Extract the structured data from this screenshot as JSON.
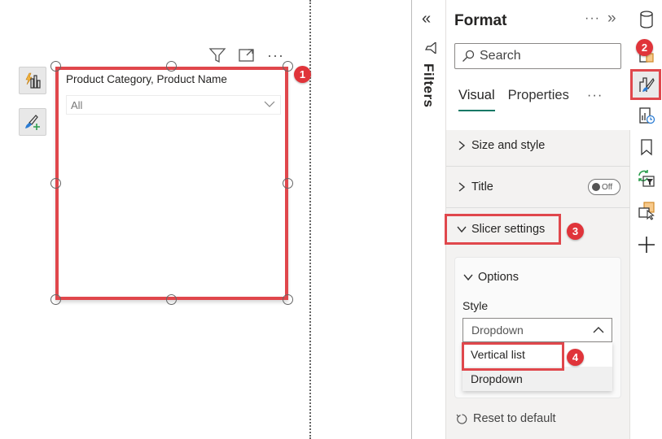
{
  "canvas": {
    "visual_header_icons": [
      "filter-icon",
      "focus-mode-icon",
      "more-options-icon"
    ],
    "side_buttons": [
      {
        "name": "build-visual-icon"
      },
      {
        "name": "format-visual-icon"
      }
    ],
    "slicer": {
      "title": "Product Category, Product Name",
      "dropdown_value": "All"
    }
  },
  "filters_pane": {
    "label": "Filters",
    "collapse_glyph": "«"
  },
  "format_pane": {
    "title": "Format",
    "more_glyph": "···",
    "expand_glyph": "»",
    "search_placeholder": "Search",
    "tabs": [
      {
        "label": "Visual",
        "active": true
      },
      {
        "label": "Properties",
        "active": false
      }
    ],
    "tabs_more": "···",
    "sections": [
      {
        "label": "Size and style",
        "expanded": false
      },
      {
        "label": "Title",
        "expanded": false,
        "toggle": "Off"
      },
      {
        "label": "Slicer settings",
        "expanded": true
      }
    ],
    "options": {
      "title": "Options",
      "style_label": "Style",
      "style_value": "Dropdown",
      "dropdown_options": [
        "Vertical list",
        "Dropdown"
      ]
    },
    "reset_label": "Reset to default"
  },
  "right_rail": {
    "icons": [
      "data-icon",
      "build-icon",
      "format-icon",
      "analytics-icon",
      "bookmark-icon",
      "sync-filter-icon",
      "selection-icon",
      "add-icon"
    ]
  },
  "annotations": {
    "badges": [
      "1",
      "2",
      "3",
      "4"
    ],
    "highlight_color": "#e0474c"
  }
}
